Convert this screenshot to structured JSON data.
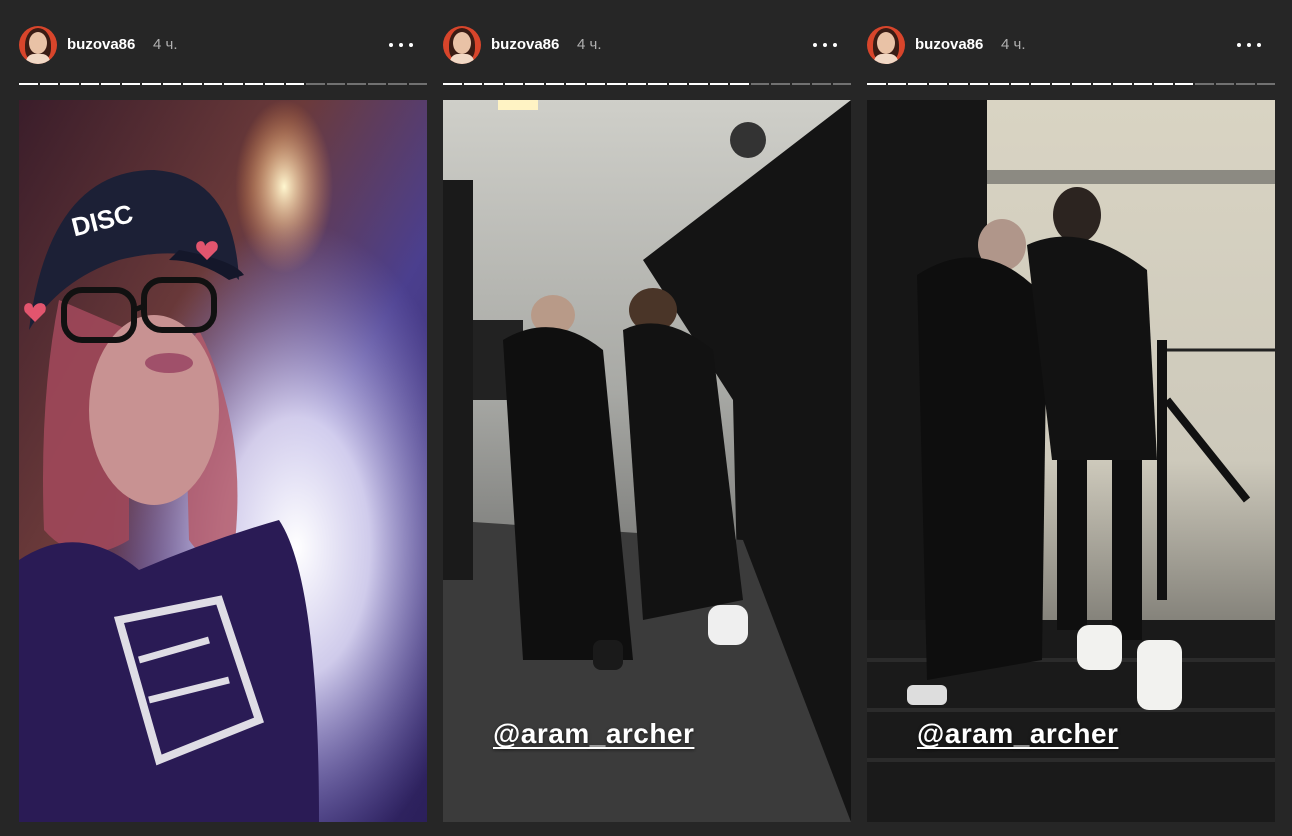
{
  "stories": [
    {
      "username": "buzova86",
      "time": "4 ч.",
      "mention": "",
      "progress": {
        "segments": 20,
        "completed": 14
      }
    },
    {
      "username": "buzova86",
      "time": "4 ч.",
      "mention": "@aram_archer",
      "progress": {
        "segments": 20,
        "completed": 15
      }
    },
    {
      "username": "buzova86",
      "time": "4 ч.",
      "mention": "@aram_archer",
      "progress": {
        "segments": 20,
        "completed": 16
      }
    }
  ],
  "icons": {
    "more": "more-dots-icon"
  },
  "colors": {
    "background": "#262626",
    "progress_done": "#ffffff",
    "progress_pending": "#6b6b6b",
    "avatar_ring": "#d8452b"
  }
}
